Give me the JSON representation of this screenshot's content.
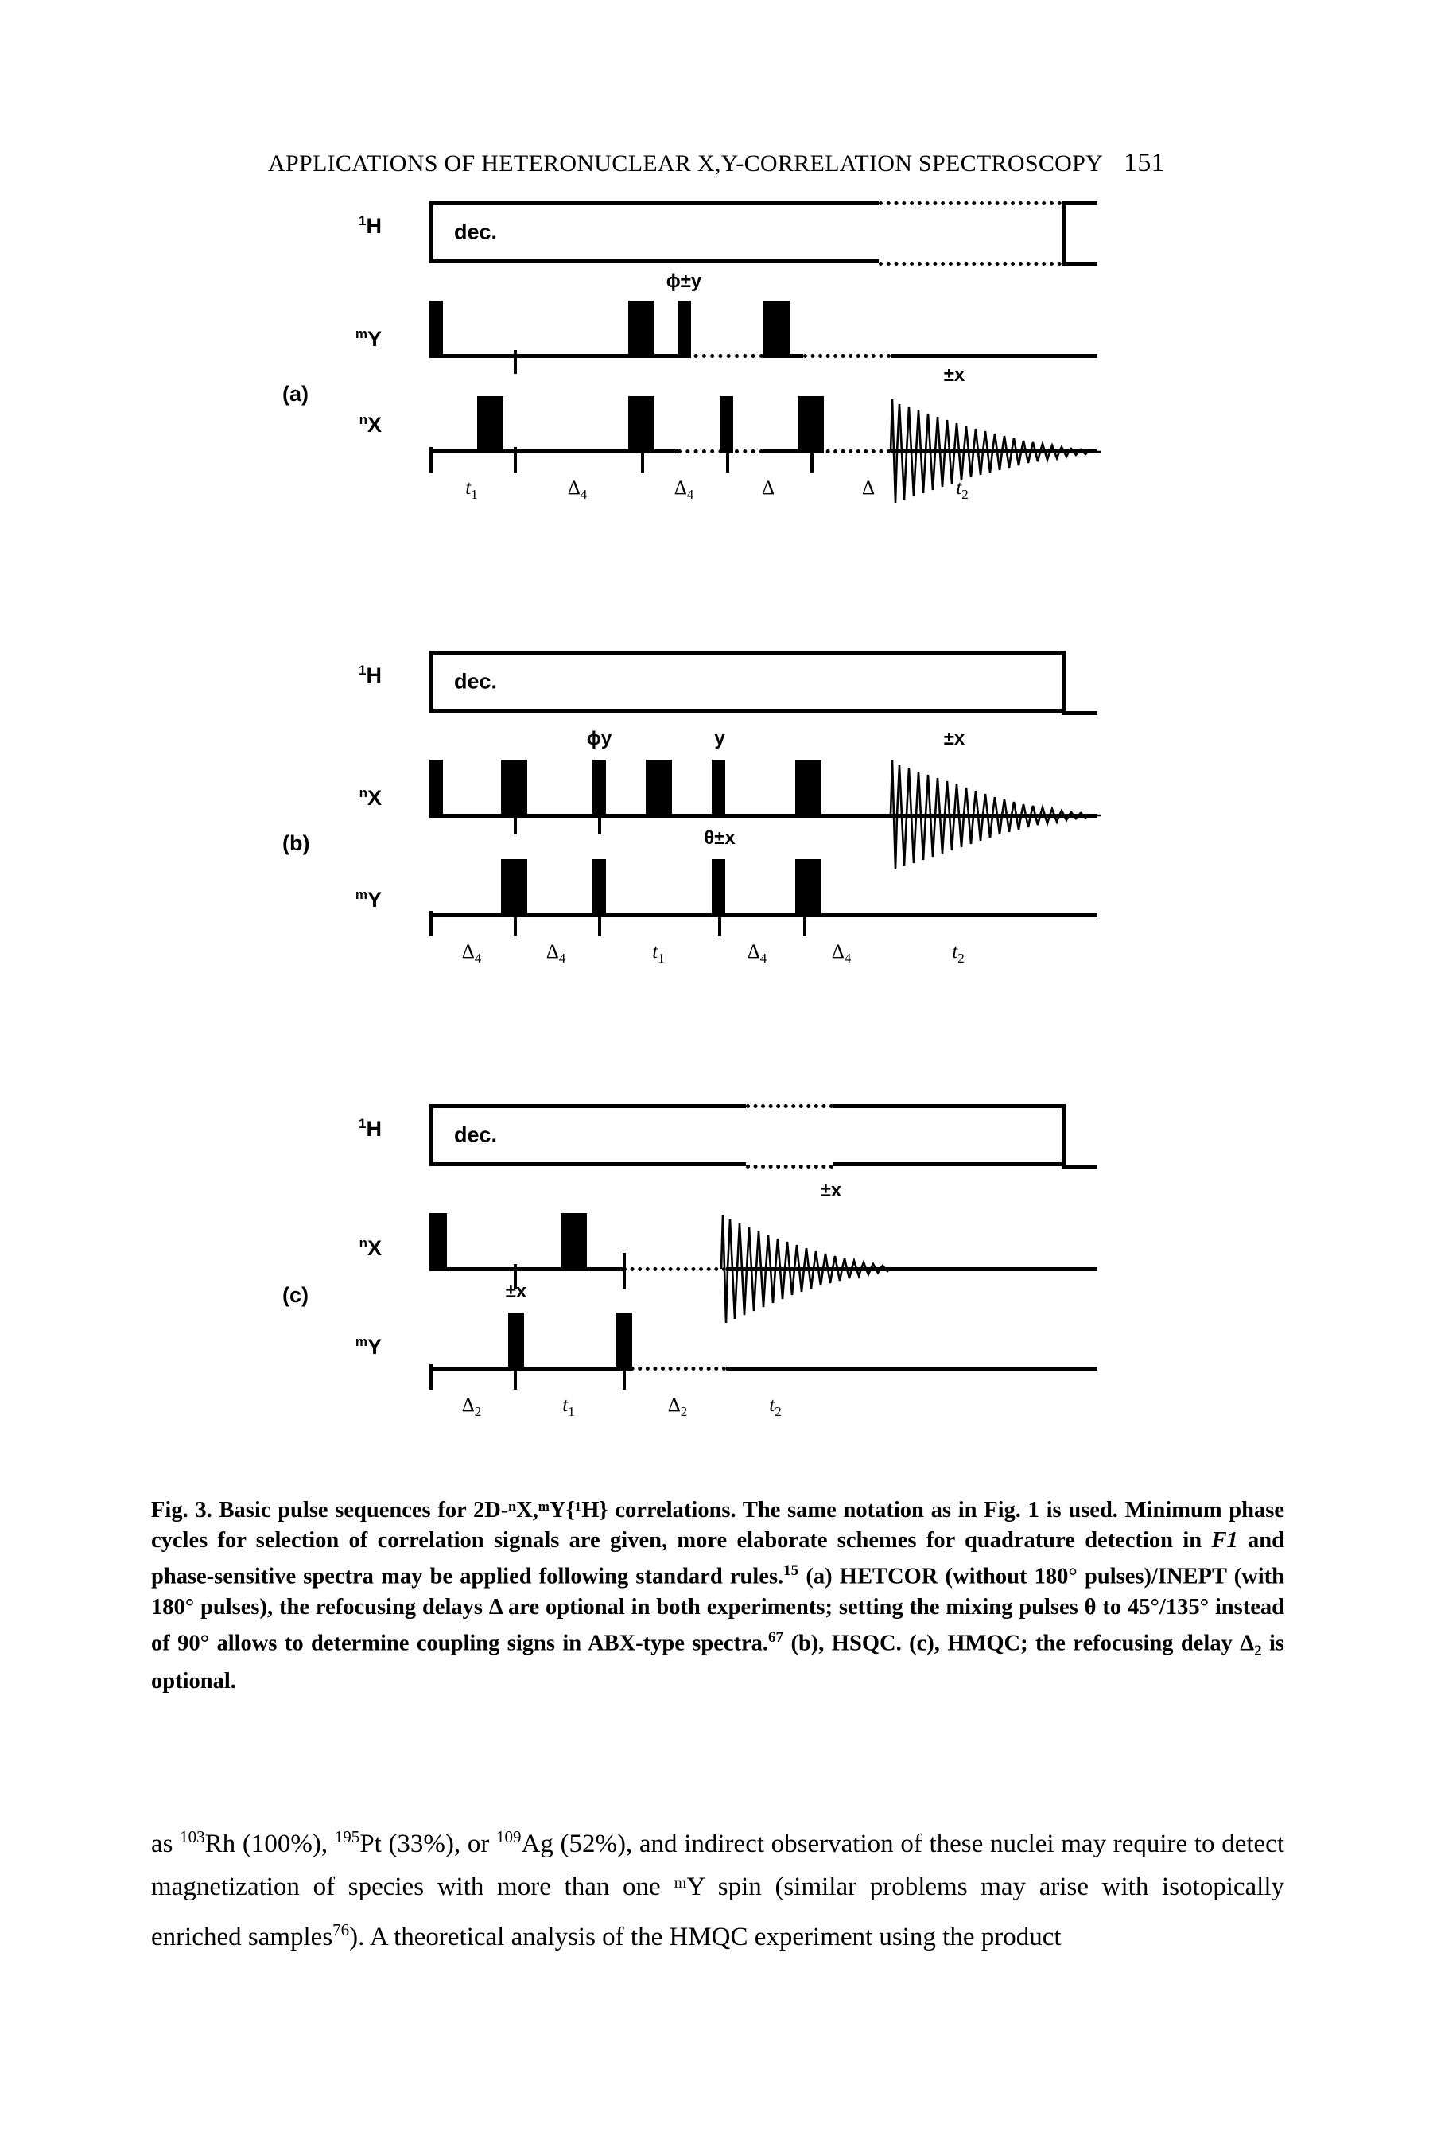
{
  "running_head": {
    "title": "APPLICATIONS OF HETERONUCLEAR X,Y-CORRELATION SPECTROSCOPY",
    "page_number": "151"
  },
  "figure": {
    "panels": [
      {
        "id": "a",
        "label": "(a)",
        "experiment": "HETCOR/INEPT",
        "channels": [
          {
            "name": "proton",
            "label_prefix": "1",
            "label": "H",
            "type": "decoupler",
            "decoupler_text": "dec."
          },
          {
            "name": "mY",
            "label_prefix": "m",
            "label": "Y",
            "type": "pulses"
          },
          {
            "name": "nX",
            "label_prefix": "n",
            "label": "X",
            "type": "pulses"
          }
        ],
        "phase_labels": [
          {
            "text": "ϕ±y",
            "channel": "mY"
          },
          {
            "text": "±x",
            "channel": "nX"
          }
        ],
        "time_labels": [
          "t1",
          "Δ4",
          "Δ4",
          "Δ",
          "Δ",
          "t2"
        ]
      },
      {
        "id": "b",
        "label": "(b)",
        "experiment": "HSQC",
        "channels": [
          {
            "name": "proton",
            "label_prefix": "1",
            "label": "H",
            "type": "decoupler",
            "decoupler_text": "dec."
          },
          {
            "name": "nX",
            "label_prefix": "n",
            "label": "X",
            "type": "pulses"
          },
          {
            "name": "mY",
            "label_prefix": "m",
            "label": "Y",
            "type": "pulses"
          }
        ],
        "phase_labels": [
          {
            "text": "ϕy",
            "channel": "nX"
          },
          {
            "text": "y",
            "channel": "nX"
          },
          {
            "text": "±x",
            "channel": "nX"
          },
          {
            "text": "θ±x",
            "channel": "mY"
          }
        ],
        "time_labels": [
          "Δ4",
          "Δ4",
          "t1",
          "Δ4",
          "Δ4",
          "t2"
        ]
      },
      {
        "id": "c",
        "label": "(c)",
        "experiment": "HMQC",
        "channels": [
          {
            "name": "proton",
            "label_prefix": "1",
            "label": "H",
            "type": "decoupler",
            "decoupler_text": "dec."
          },
          {
            "name": "nX",
            "label_prefix": "n",
            "label": "X",
            "type": "pulses"
          },
          {
            "name": "mY",
            "label_prefix": "m",
            "label": "Y",
            "type": "pulses"
          }
        ],
        "phase_labels": [
          {
            "text": "±x",
            "channel": "nX"
          },
          {
            "text": "±x",
            "channel": "mY"
          }
        ],
        "time_labels": [
          "Δ2",
          "t1",
          "Δ2",
          "t2"
        ]
      }
    ]
  },
  "caption": {
    "figure_number": "Fig. 3.",
    "text_part1": "Basic pulse sequences for 2D-",
    "nuclei": "ⁿX,ᵐY{¹H}",
    "text_part2": " correlations. The same notation as in Fig. 1 is used. Minimum phase cycles for selection of correlation signals are given, more elaborate schemes for quadrature detection in ",
    "f1": "F1",
    "text_part3": " and phase-sensitive spectra may be applied following standard rules.",
    "ref15": "15",
    "text_part4": " (a) HETCOR (without 180° pulses)/INEPT (with 180° pulses), the refocusing delays Δ are optional in both experiments; setting the mixing pulses θ to 45°/135° instead of 90° allows to determine coupling signs in ABX-type spectra.",
    "ref67": "67",
    "text_part5": " (b), HSQC. (c), HMQC; the refocusing delay Δ",
    "delta_sub": "2",
    "text_part6": " is optional."
  },
  "body": {
    "text_part1": "as ",
    "sup103": "103",
    "text_part2": "Rh (100%), ",
    "sup195": "195",
    "text_part3": "Pt (33%), or ",
    "sup109": "109",
    "text_part4": "Ag (52%), and indirect observation of these nuclei may require to detect magnetization of species with more than one ",
    "mY": "ᵐY",
    "text_part5": " spin (similar problems may arise with isotopically enriched samples",
    "sup76": "76",
    "text_part6": "). A theoretical analysis of the HMQC experiment using the product"
  }
}
